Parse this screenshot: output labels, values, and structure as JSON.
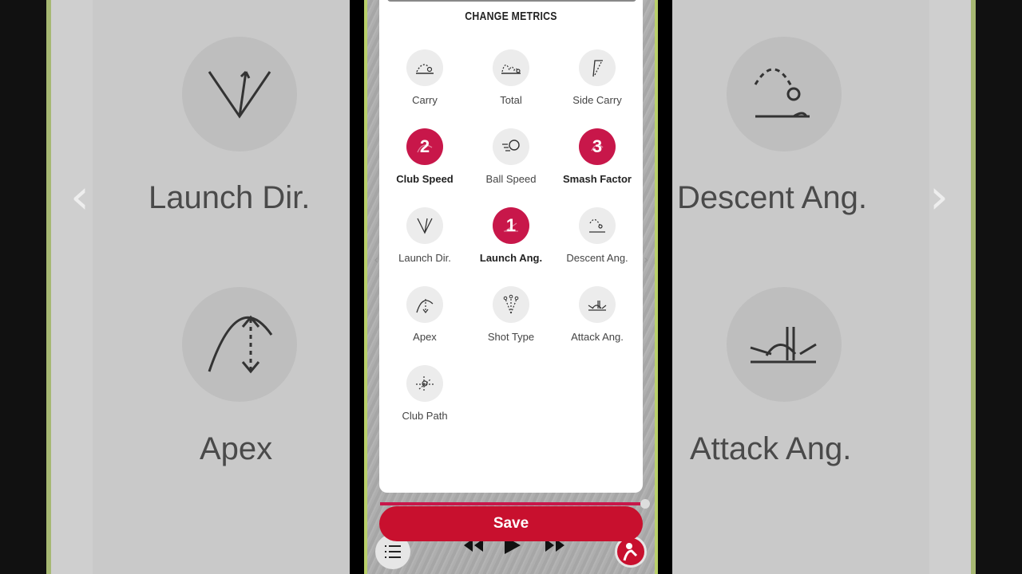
{
  "modal": {
    "title": "CHANGE METRICS",
    "save_label": "Save"
  },
  "metrics": [
    {
      "label": "Carry",
      "icon": "carry-icon",
      "selected": false,
      "order": ""
    },
    {
      "label": "Total",
      "icon": "total-icon",
      "selected": false,
      "order": ""
    },
    {
      "label": "Side Carry",
      "icon": "side-carry-icon",
      "selected": false,
      "order": ""
    },
    {
      "label": "Club Speed",
      "icon": "club-speed-icon",
      "selected": true,
      "order": "2"
    },
    {
      "label": "Ball Speed",
      "icon": "ball-speed-icon",
      "selected": false,
      "order": ""
    },
    {
      "label": "Smash Factor",
      "icon": "smash-factor-icon",
      "selected": true,
      "order": "3"
    },
    {
      "label": "Launch Dir.",
      "icon": "launch-dir-icon",
      "selected": false,
      "order": ""
    },
    {
      "label": "Launch Ang.",
      "icon": "launch-ang-icon",
      "selected": true,
      "order": "1"
    },
    {
      "label": "Descent Ang.",
      "icon": "descent-ang-icon",
      "selected": false,
      "order": ""
    },
    {
      "label": "Apex",
      "icon": "apex-icon",
      "selected": false,
      "order": ""
    },
    {
      "label": "Shot Type",
      "icon": "shot-type-icon",
      "selected": false,
      "order": ""
    },
    {
      "label": "Attack Ang.",
      "icon": "attack-ang-icon",
      "selected": false,
      "order": ""
    },
    {
      "label": "Club Path",
      "icon": "club-path-icon",
      "selected": false,
      "order": ""
    }
  ],
  "background": {
    "left_top": "Launch Dir.",
    "left_bottom": "Apex",
    "right_top": "Descent Ang.",
    "right_bottom": "Attack Ang."
  },
  "video": {
    "progress": 0.97
  },
  "colors": {
    "accent": "#c8174a",
    "save": "#c8102e",
    "frame": "#b9d06a"
  }
}
